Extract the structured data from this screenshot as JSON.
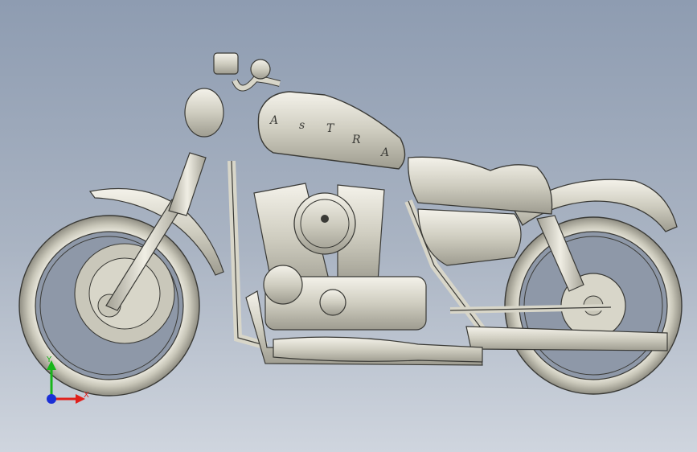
{
  "triad": {
    "x_label": "X",
    "y_label": "Y",
    "x_color": "#e0201b",
    "y_color": "#17b51a",
    "z_color": "#1a2fd6"
  },
  "tank_script": [
    "A",
    "s",
    "T",
    "R",
    "A"
  ],
  "model": {
    "body_color": "#d8d6c9",
    "edge_color": "#3a3a36",
    "background_top": "#8e9cb1",
    "background_bottom": "#cfd5de"
  }
}
